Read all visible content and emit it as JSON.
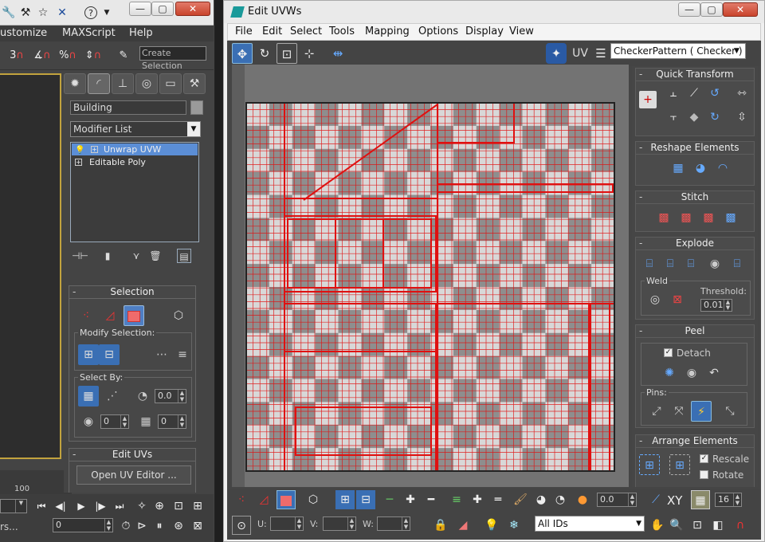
{
  "left_window": {
    "menu": [
      "ustomize",
      "MAXScript",
      "Help"
    ],
    "create_selection_placeholder": "Create Selection",
    "object_name": "Building",
    "modifier_list": "Modifier List",
    "stack": [
      "Unwrap UVW",
      "Editable Poly"
    ],
    "selection_rollout": {
      "title": "Selection",
      "modify_selection": "Modify Selection:",
      "select_by": "Select By:",
      "angle_value": "0.0",
      "spin1": "0",
      "spin2": "0"
    },
    "edit_uvs": {
      "title": "Edit UVs",
      "open_button": "Open UV Editor ..."
    },
    "timeline_number": "100",
    "bottom_value": "0",
    "bottom_left_text": "rs..."
  },
  "right_window": {
    "title": "Edit UVWs",
    "menu": [
      "File",
      "Edit",
      "Select",
      "Tools",
      "Mapping",
      "Options",
      "Display",
      "View"
    ],
    "uv_label": "UV",
    "texture_select": "CheckerPattern  ( Checker )",
    "panels": {
      "quick_transform": "Quick Transform",
      "reshape": "Reshape Elements",
      "stitch": "Stitch",
      "explode": "Explode",
      "weld": "Weld",
      "threshold_label": "Threshold:",
      "threshold_value": "0.01",
      "peel": "Peel",
      "detach": "Detach",
      "pins": "Pins:",
      "arrange": "Arrange Elements",
      "rescale": "Rescale",
      "rotate": "Rotate"
    },
    "bottom": {
      "soft_value": "0.0",
      "xy": "XY",
      "grid_value": "16",
      "u_label": "U:",
      "v_label": "V:",
      "w_label": "W:",
      "ids_select": "All IDs"
    }
  },
  "colors": {
    "accent_red": "#e01010",
    "selection_blue": "#5b8ed6",
    "checker_light": "#d8d8d8",
    "checker_dark": "#8e8e8e"
  }
}
